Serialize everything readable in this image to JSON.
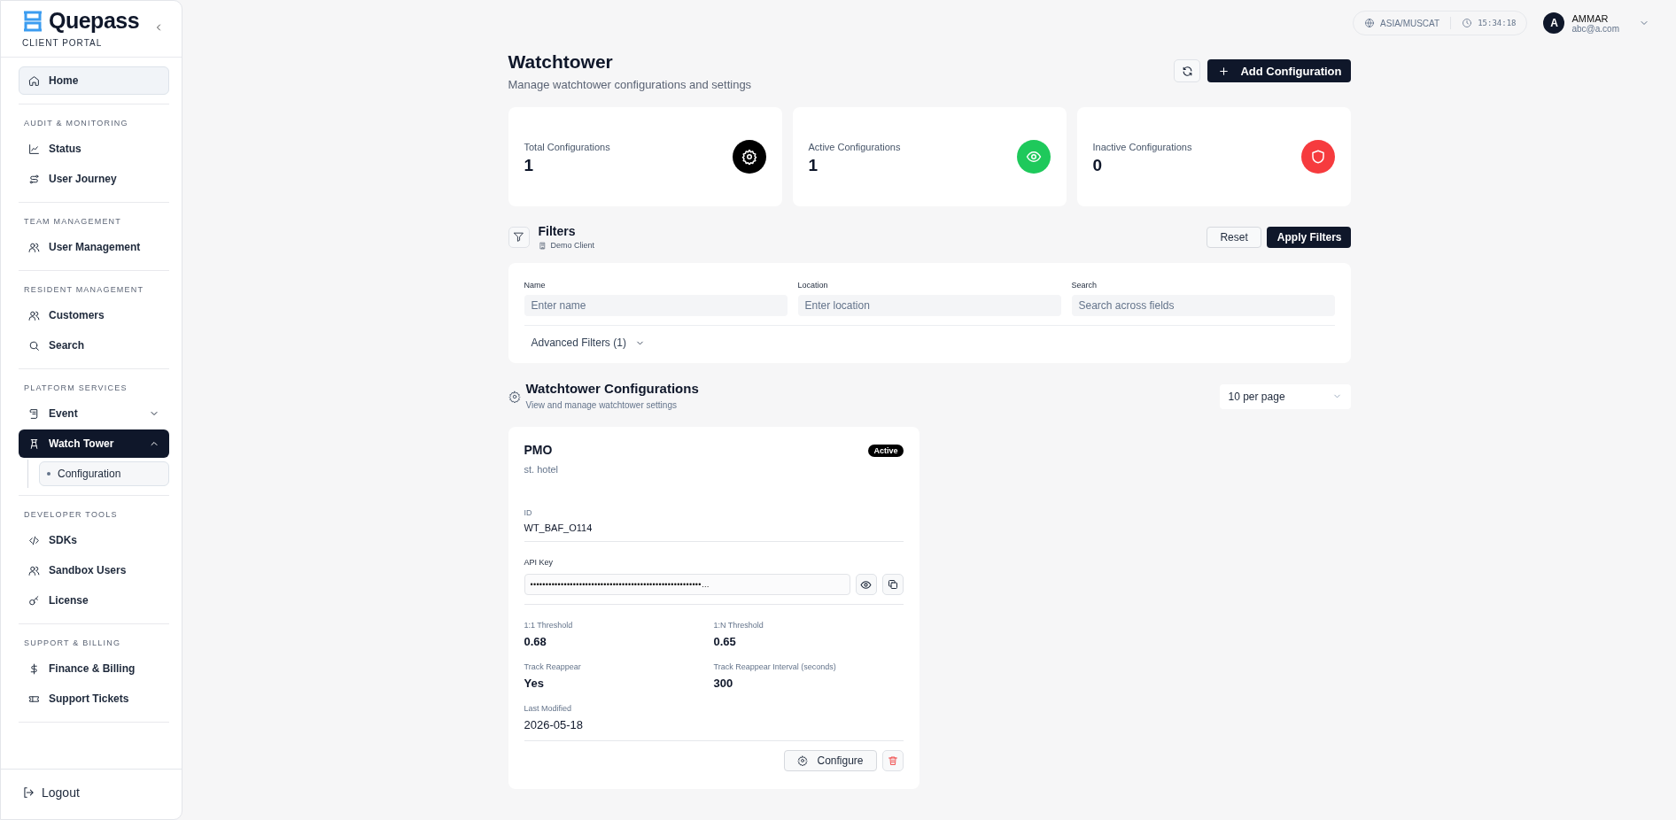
{
  "sidebar": {
    "logo": "Quepass",
    "subtitle": "CLIENT PORTAL",
    "sections": [
      {
        "items": [
          {
            "label": "Home",
            "selected": true
          }
        ]
      },
      {
        "title": "AUDIT & MONITORING",
        "items": [
          {
            "label": "Status",
            "selected": false
          },
          {
            "label": "User Journey",
            "selected": false
          }
        ]
      },
      {
        "title": "TEAM MANAGEMENT",
        "items": [
          {
            "label": "User Management",
            "selected": false
          }
        ]
      },
      {
        "title": "RESIDENT MANAGEMENT",
        "items": [
          {
            "label": "Customers",
            "selected": false
          },
          {
            "label": "Search",
            "selected": false
          }
        ]
      },
      {
        "title": "PLATFORM SERVICES",
        "items": [
          {
            "label": "Event",
            "selected": false,
            "expanded": false
          },
          {
            "label": "Watch Tower",
            "selected": true,
            "expanded": true,
            "children": [
              {
                "label": "Configuration",
                "selected": true
              }
            ]
          }
        ]
      },
      {
        "title": "DEVELOPER TOOLS",
        "items": [
          {
            "label": "SDKs",
            "selected": false
          },
          {
            "label": "Sandbox Users",
            "selected": false
          },
          {
            "label": "License",
            "selected": false
          }
        ]
      },
      {
        "title": "SUPPORT & BILLING",
        "items": [
          {
            "label": "Finance & Billing",
            "selected": false
          },
          {
            "label": "Support Tickets",
            "selected": false
          }
        ]
      }
    ],
    "logout": "Logout"
  },
  "header": {
    "timezone": "ASIA/MUSCAT",
    "time": "15:34:18",
    "user": {
      "initial": "A",
      "name": "AMMAR",
      "email": "abc@a.com"
    }
  },
  "page": {
    "title": "Watchtower",
    "subtitle": "Manage watchtower configurations and settings",
    "add_button": "Add Configuration"
  },
  "stats": [
    {
      "label": "Total Configurations",
      "value": "1",
      "color": "#000000"
    },
    {
      "label": "Active Configurations",
      "value": "1",
      "color": "#1ec95b"
    },
    {
      "label": "Inactive Configurations",
      "value": "0",
      "color": "#f63b3e"
    }
  ],
  "filters": {
    "title": "Filters",
    "client": "Demo Client",
    "reset": "Reset",
    "apply": "Apply Filters",
    "fields": [
      {
        "label": "Name",
        "placeholder": "Enter name"
      },
      {
        "label": "Location",
        "placeholder": "Enter location"
      },
      {
        "label": "Search",
        "placeholder": "Search across fields"
      }
    ],
    "advanced": "Advanced Filters (1)"
  },
  "configurations": {
    "title": "Watchtower Configurations",
    "subtitle": "View and manage watchtower settings",
    "page_size": "10 per page",
    "cards": [
      {
        "name": "PMO",
        "location": "st. hotel",
        "status": "Active",
        "id_label": "ID",
        "id": "WT_BAF_O114",
        "api_key_label": "API Key",
        "api_key": "••••••••••••••••••••••••••••••••••••••••••••••••••••••••…",
        "details": [
          {
            "label": "1:1 Threshold",
            "value": "0.68"
          },
          {
            "label": "1:N Threshold",
            "value": "0.65"
          },
          {
            "label": "Track Reappear",
            "value": "Yes"
          },
          {
            "label": "Track Reappear Interval (seconds)",
            "value": "300"
          },
          {
            "label": "Last Modified",
            "value": "2026-05-18"
          }
        ],
        "configure": "Configure"
      }
    ]
  }
}
